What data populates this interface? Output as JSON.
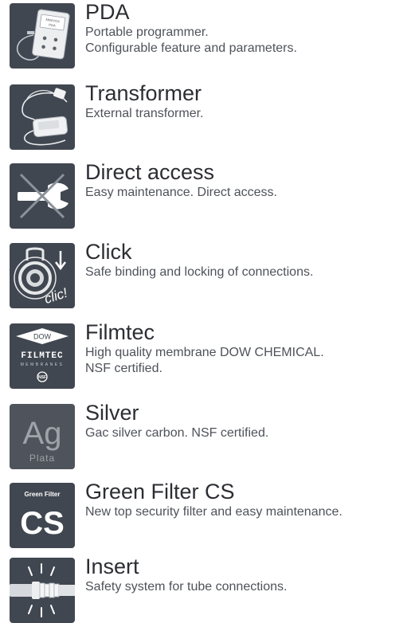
{
  "features": [
    {
      "icon": "pda-icon",
      "title": "PDA",
      "description": [
        "Portable programmer.",
        "Configurable feature and parameters."
      ],
      "icon_text": [
        "MINIVOX",
        "PDA"
      ]
    },
    {
      "icon": "transformer-icon",
      "title": "Transformer",
      "description": [
        "External transformer."
      ]
    },
    {
      "icon": "direct-access-icon",
      "title": "Direct access",
      "description": [
        "Easy maintenance. Direct access."
      ]
    },
    {
      "icon": "click-icon",
      "title": "Click",
      "description": [
        "Safe binding and locking of connections."
      ],
      "icon_text": [
        "clic!"
      ]
    },
    {
      "icon": "filmtec-logo-icon",
      "title": "Filmtec",
      "description": [
        "High quality membrane DOW CHEMICAL.",
        "NSF certified."
      ],
      "icon_text": [
        "DOW",
        "FILMTEC",
        "MEMBRANES",
        "NSF"
      ]
    },
    {
      "icon": "silver-icon",
      "title": "Silver",
      "description": [
        "Gac silver carbon. NSF certified."
      ],
      "icon_text": [
        "Ag",
        "Plata"
      ]
    },
    {
      "icon": "green-filter-cs-icon",
      "title": "Green Filter CS",
      "description": [
        "New top security filter and easy maintenance."
      ],
      "icon_text": [
        "Green Filter",
        "CS"
      ]
    },
    {
      "icon": "insert-icon",
      "title": "Insert",
      "description": [
        "Safety system for tube connections."
      ]
    }
  ],
  "colors": {
    "tile_background": "#414750",
    "title_text": "#2c2e33",
    "description_text": "#4e5259"
  }
}
